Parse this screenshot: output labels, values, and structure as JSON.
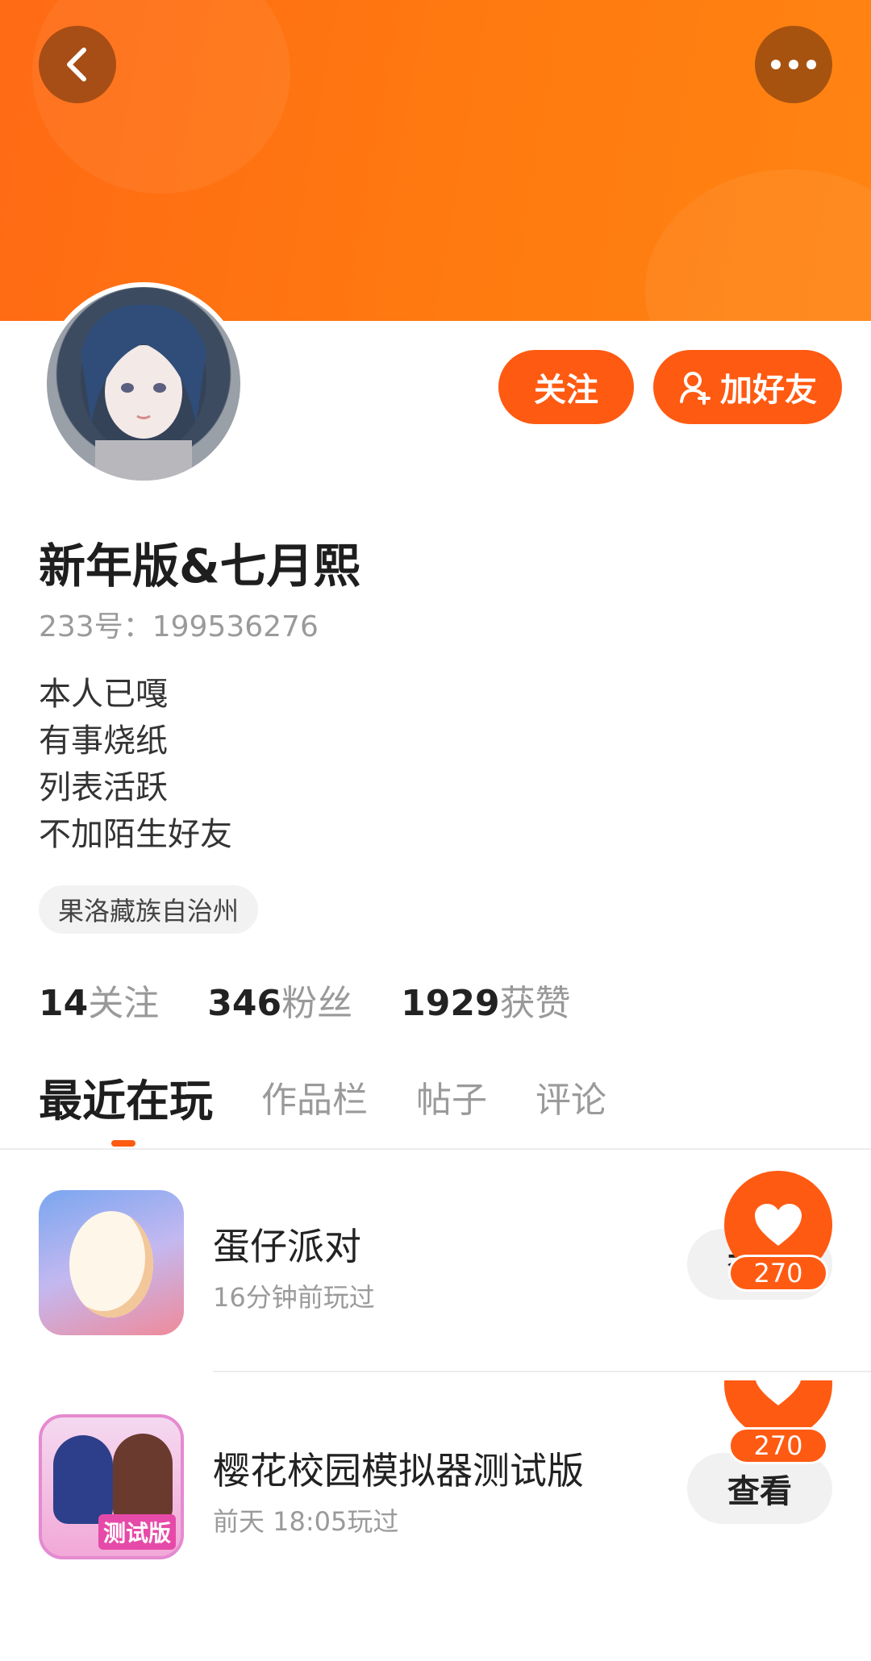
{
  "colors": {
    "brand": "#ff5a12",
    "banner": "#ff7a10"
  },
  "header": {
    "back_icon": "chevron-left-icon",
    "more_icon": "more-dots-icon"
  },
  "profile": {
    "follow_label": "关注",
    "add_friend_label": "加好友",
    "username": "新年版&七月熙",
    "account_id": "233号：199536276",
    "bio": [
      "本人已嘎",
      "有事烧纸",
      "列表活跃",
      "不加陌生好友"
    ],
    "location": "果洛藏族自治州"
  },
  "stats": [
    {
      "num": "14",
      "label": "关注"
    },
    {
      "num": "346",
      "label": "粉丝"
    },
    {
      "num": "1929",
      "label": "获赞"
    }
  ],
  "tabs": [
    {
      "label": "最近在玩",
      "active": true
    },
    {
      "label": "作品栏",
      "active": false
    },
    {
      "label": "帖子",
      "active": false
    },
    {
      "label": "评论",
      "active": false
    }
  ],
  "games": [
    {
      "title": "蛋仔派对",
      "played": "16分钟前玩过",
      "button": "查看"
    },
    {
      "title": "樱花校园模拟器测试版",
      "played": "前天 18:05玩过",
      "button": "查看",
      "icon_badge": "测试版"
    }
  ],
  "like_widget": {
    "count_1": "270",
    "count_2": "270"
  }
}
